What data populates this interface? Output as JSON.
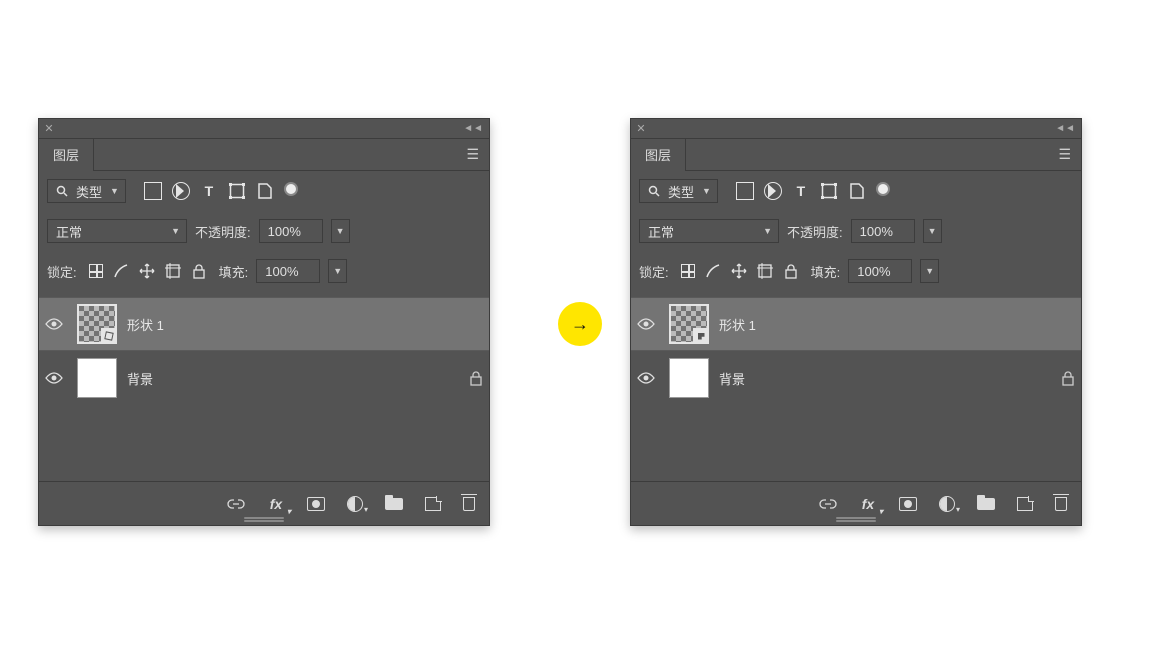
{
  "panel_title": "图层",
  "filter": {
    "type_label": "类型"
  },
  "blend": {
    "mode": "正常",
    "opacity_label": "不透明度:",
    "opacity_value": "100%"
  },
  "lock": {
    "label": "锁定:",
    "fill_label": "填充:",
    "fill_value": "100%"
  },
  "layers": [
    {
      "name": "形状 1",
      "locked": false
    },
    {
      "name": "背景",
      "locked": true
    }
  ],
  "arrow": "→"
}
